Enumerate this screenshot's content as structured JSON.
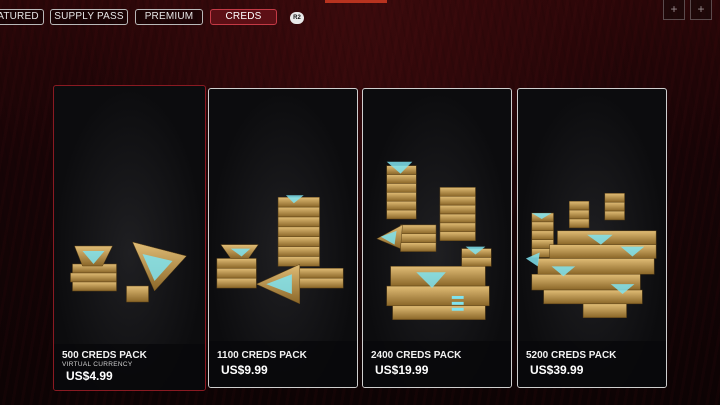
{
  "tabs": [
    {
      "label": "ATURED"
    },
    {
      "label": "SUPPLY PASS"
    },
    {
      "label": "PREMIUM"
    },
    {
      "label": "CREDS",
      "active": true
    }
  ],
  "r2_hint": "R2",
  "corner_buttons": [
    "+",
    "+"
  ],
  "colors": {
    "accent": "#b8331f",
    "active_tab": "#5c0f15",
    "selected_border": "#8a1a22",
    "crystal": "#7fe3f0",
    "gold": "#c9a15a"
  },
  "packs": [
    {
      "name": "500 CREDS PACK",
      "subtitle": "VIRTUAL CURRENCY",
      "price": "US$4.99",
      "selected": true
    },
    {
      "name": "1100 CREDS PACK",
      "price": "US$9.99"
    },
    {
      "name": "2400 CREDS PACK",
      "price": "US$19.99"
    },
    {
      "name": "5200 CREDS PACK",
      "price": "US$39.99"
    }
  ]
}
